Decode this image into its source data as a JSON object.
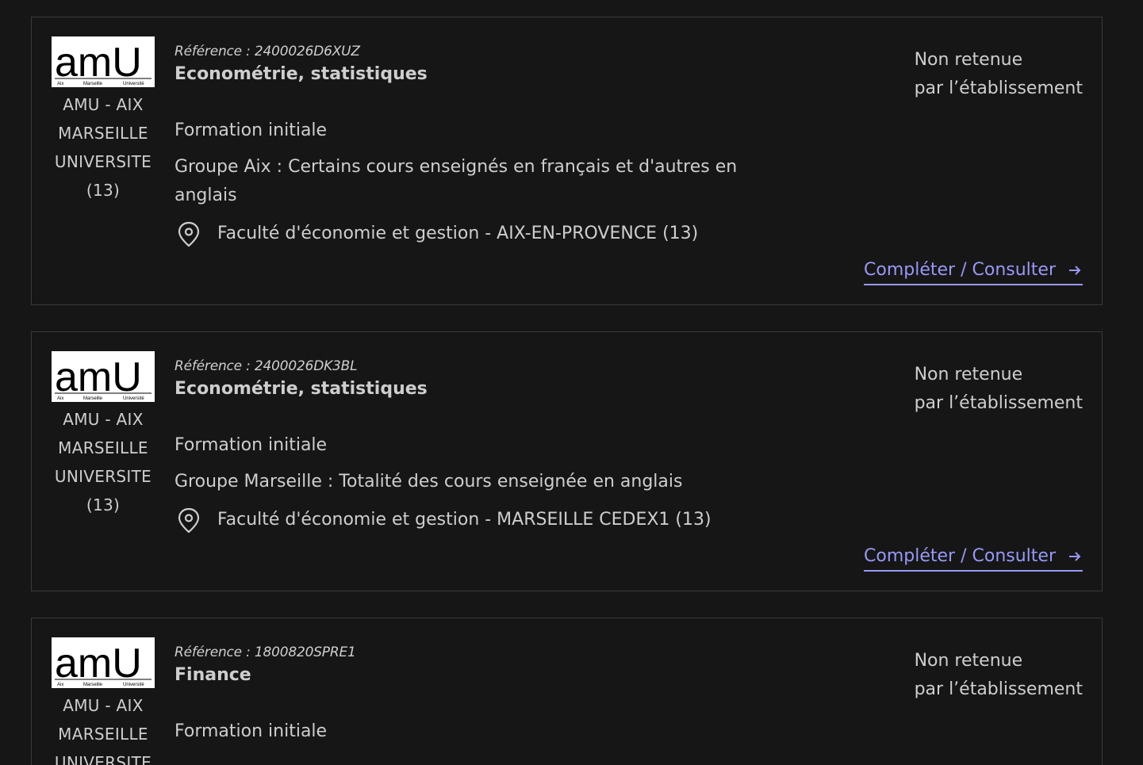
{
  "colors": {
    "background": "#161616",
    "card_border": "#3a3a3a",
    "text": "#cecece",
    "link": "#9898f8"
  },
  "logo": {
    "mark": "amU",
    "sub_left": "Aix",
    "sub_mid": "Marseille",
    "sub_right": "Université"
  },
  "cards": [
    {
      "institution": [
        "AMU - AIX",
        "MARSEILLE",
        "UNIVERSITE",
        "(13)"
      ],
      "reference": "Référence : 2400026D6XUZ",
      "title": "Econométrie, statistiques",
      "type": "Formation initiale",
      "detail": "Groupe Aix : Certains cours enseignés en français et d'autres en anglais",
      "place": "Faculté d'économie et gestion - AIX-EN-PROVENCE (13)",
      "status_line1": "Non retenue",
      "status_line2": "par l’établissement",
      "action": "Compléter / Consulter",
      "icons": {
        "place": "map-pin-icon",
        "action": "arrow-right-icon"
      }
    },
    {
      "institution": [
        "AMU - AIX",
        "MARSEILLE",
        "UNIVERSITE",
        "(13)"
      ],
      "reference": "Référence : 2400026DK3BL",
      "title": "Econométrie, statistiques",
      "type": "Formation initiale",
      "detail": "Groupe Marseille : Totalité des cours enseignée en anglais",
      "place": "Faculté d'économie et gestion - MARSEILLE CEDEX1 (13)",
      "status_line1": "Non retenue",
      "status_line2": "par l’établissement",
      "action": "Compléter / Consulter",
      "icons": {
        "place": "map-pin-icon",
        "action": "arrow-right-icon"
      }
    },
    {
      "institution": [
        "AMU - AIX",
        "MARSEILLE",
        "UNIVERSITE"
      ],
      "reference": "Référence : 1800820SPRE1",
      "title": "Finance",
      "type": "Formation initiale",
      "status_line1": "Non retenue",
      "status_line2": "par l’établissement"
    }
  ]
}
